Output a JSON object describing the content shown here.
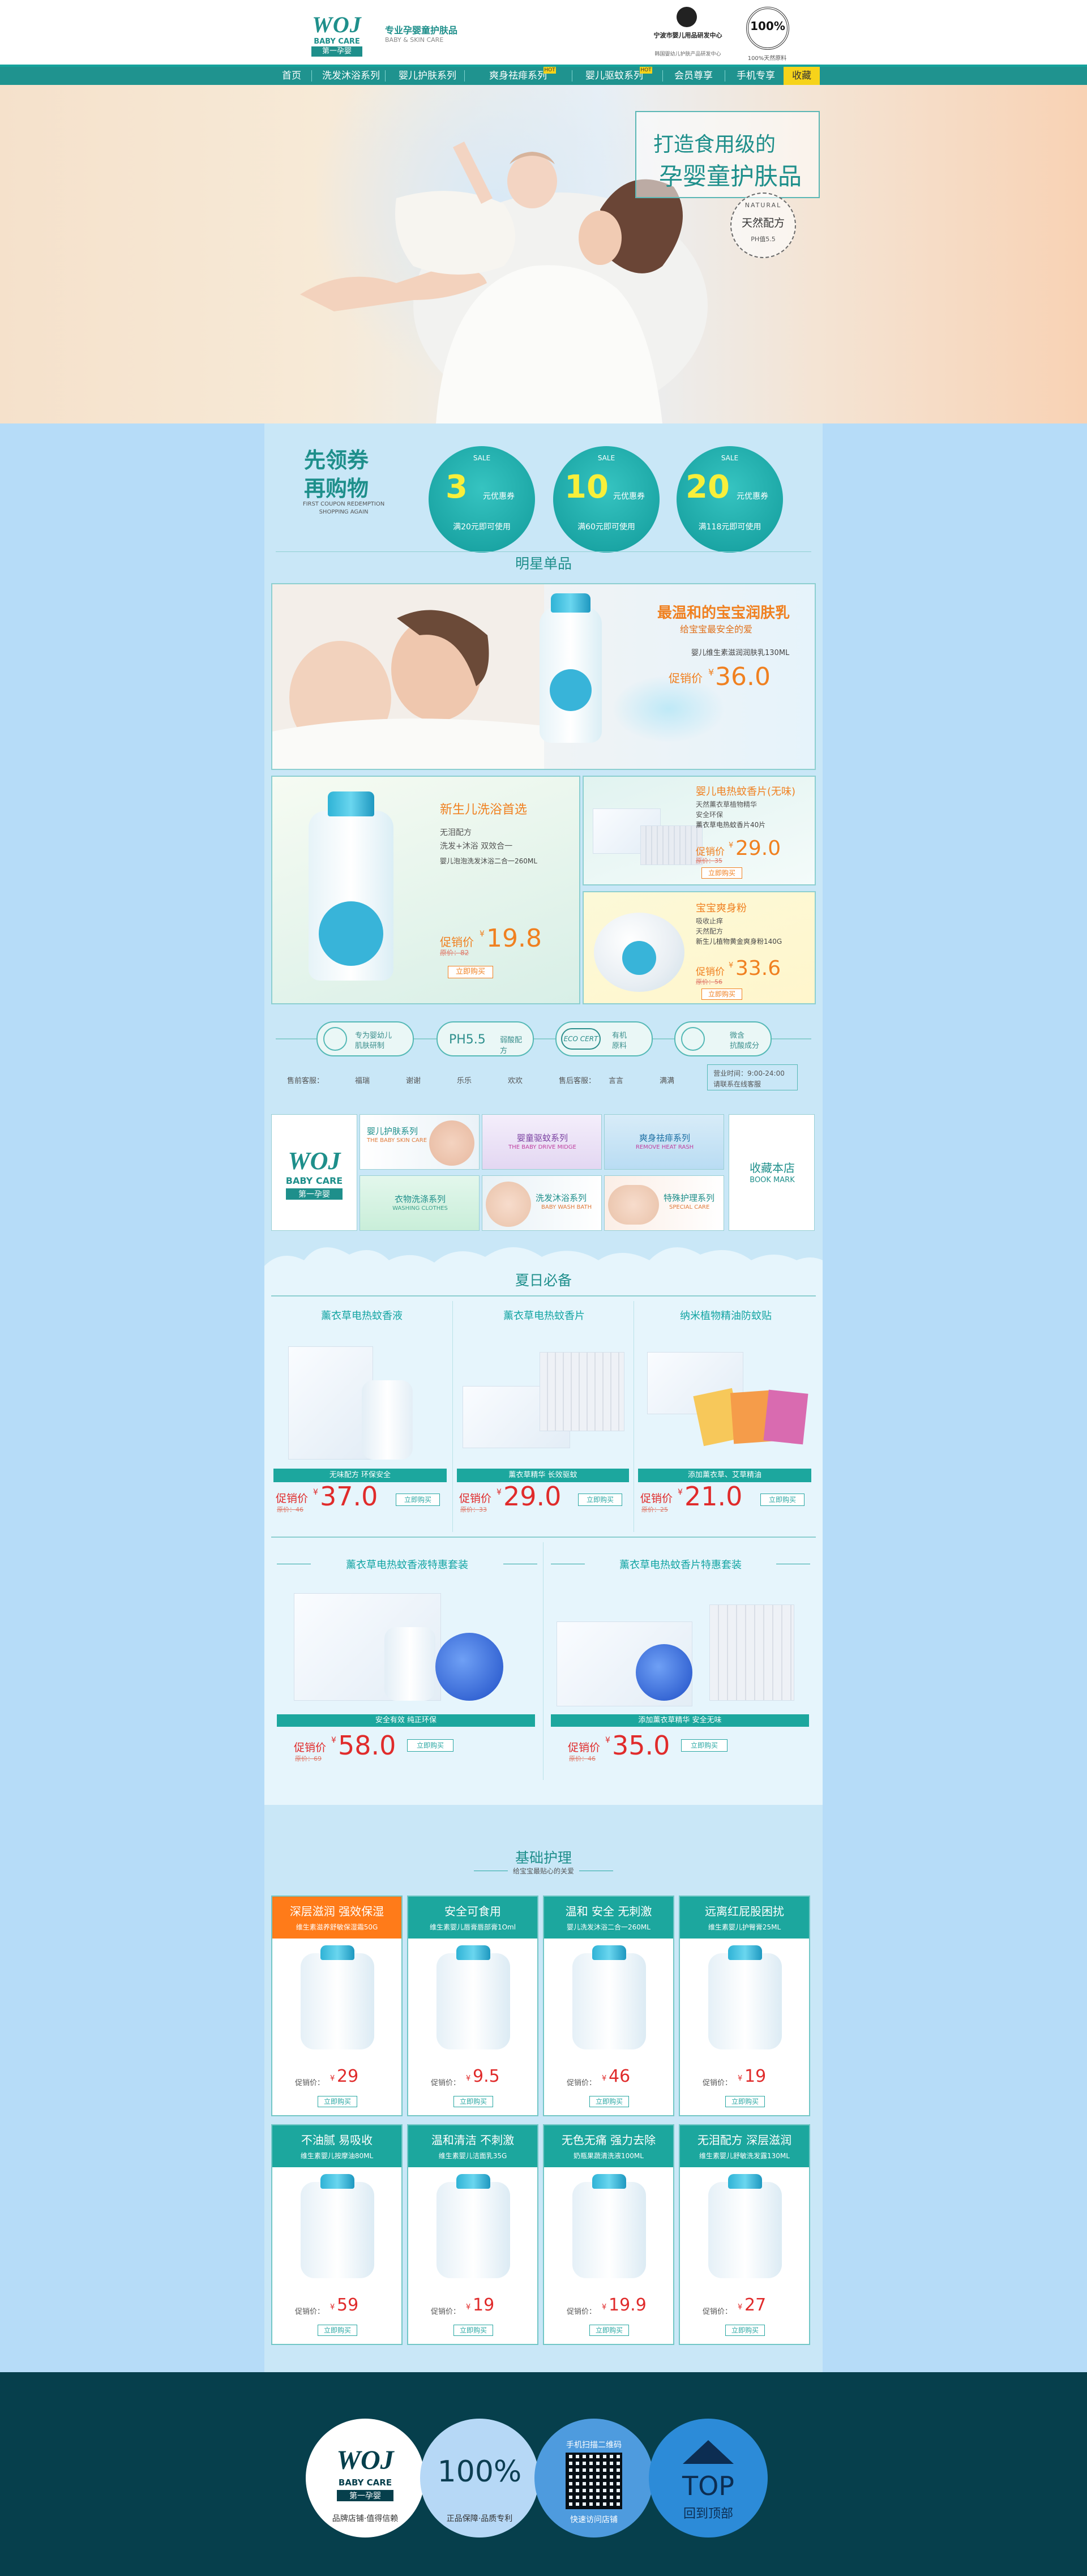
{
  "header": {
    "brand_en": "BABY CARE",
    "brand_cn": "第一孕婴",
    "brand_logo": "WOJ",
    "tagline": "专业孕婴童护肤品",
    "tagline_en": "BABY & SKIN CARE",
    "cert_text_1": "宁波市婴儿用品研发中心",
    "cert_text_2": "韩国婴幼儿护肤产品研发中心",
    "badge_100": "100%",
    "badge_sub": "100%天然原料"
  },
  "nav": {
    "items": [
      "首页",
      "洗发沐浴系列",
      "婴儿护肤系列",
      "爽身祛痱系列",
      "婴儿驱蚊系列",
      "会员尊享",
      "手机专享",
      "收藏"
    ],
    "hot_badge": "HOT"
  },
  "hero": {
    "slogan_1": "打造食用级的",
    "slogan_2": "孕婴童护肤品",
    "seal_top": "NATURAL",
    "seal_cn": "天然配方",
    "seal_bottom": "PH值5.5"
  },
  "coupons": {
    "title_1": "先领券",
    "title_2": "再购物",
    "subtitle": "FIRST COUPON REDEMPTION SHOPPING AGAIN",
    "items": [
      {
        "value": "3",
        "unit": "元优惠券",
        "cond": "满20元即可使用",
        "tag": "SALE"
      },
      {
        "value": "10",
        "unit": "元优惠券",
        "cond": "满60元即可使用",
        "tag": "SALE"
      },
      {
        "value": "20",
        "unit": "元优惠券",
        "cond": "满118元即可使用",
        "tag": "SALE"
      }
    ]
  },
  "star": {
    "title": "明星单品",
    "main": {
      "headline": "最温和的宝宝润肤乳",
      "sub": "给宝宝最安全的爱",
      "name": "婴儿维生素滋润润肤乳130ML",
      "label": "促销价",
      "price": "36.0",
      "currency": "¥"
    },
    "left": {
      "headline": "新生儿洗浴首选",
      "f1": "无泪配方",
      "f2": "洗发+沐浴 双效合一",
      "name": "婴儿泡泡洗发沐浴二合一260ML",
      "label": "促销价",
      "price": "19.8",
      "old": "原价：82",
      "currency": "¥",
      "btn": "立即购买"
    },
    "right1": {
      "headline": "婴儿电热蚊香片(无味)",
      "f1": "天然薰衣草植物精华",
      "f2": "安全环保",
      "name": "薰衣草电热蚊香片40片",
      "label": "促销价",
      "price": "29.0",
      "old": "原价：35",
      "currency": "¥",
      "btn": "立即购买"
    },
    "right2": {
      "headline": "宝宝爽身粉",
      "f1": "吸收止痒",
      "f2": "天然配方",
      "name": "新生儿植物黄金爽身粉140G",
      "label": "促销价",
      "price": "33.6",
      "old": "原价：56",
      "currency": "¥",
      "btn": "立即购买"
    }
  },
  "features": [
    {
      "title": "专为婴幼儿",
      "sub": "肌肤研制"
    },
    {
      "title": "PH5.5",
      "sub": "弱酸配方"
    },
    {
      "title": "有机",
      "sub": "原料",
      "logo": "ECO CERT"
    },
    {
      "title": "微含",
      "sub": "抗酸成分"
    }
  ],
  "service": {
    "presale": "售前客服：",
    "names_pre": [
      "福瑞",
      "谢谢",
      "乐乐",
      "欢欢"
    ],
    "aftersale": "售后客服：",
    "names_after": [
      "言言",
      "满满"
    ],
    "hours": "营业时间：9:00-24:00",
    "hours_sub": "请联系在线客服"
  },
  "categories": {
    "logo_en": "BABY CARE",
    "logo_cn": "第一孕婴",
    "items": [
      {
        "cn": "婴儿护肤系列",
        "en": "THE BABY SKIN CARE"
      },
      {
        "cn": "婴童驱蚊系列",
        "en": "THE BABY DRIVE MIDGE"
      },
      {
        "cn": "爽身祛痱系列",
        "en": "REMOVE HEAT RASH"
      },
      {
        "cn": "衣物洗涤系列",
        "en": "WASHING CLOTHES"
      },
      {
        "cn": "洗发沐浴系列",
        "en": "BABY WASH BATH"
      },
      {
        "cn": "特殊护理系列",
        "en": "SPECIAL CARE"
      }
    ],
    "bookmark_cn": "收藏本店",
    "bookmark_en": "BOOK MARK"
  },
  "summer": {
    "title": "夏日必备",
    "row1": [
      {
        "name": "薰衣草电热蚊香液",
        "strip": "无味配方 环保安全",
        "label": "促销价",
        "price": "37.0",
        "old": "原价：46",
        "btn": "立即购买"
      },
      {
        "name": "薰衣草电热蚊香片",
        "strip": "薰衣草精华 长效驱蚊",
        "label": "促销价",
        "price": "29.0",
        "old": "原价：33",
        "btn": "立即购买"
      },
      {
        "name": "纳米植物精油防蚊贴",
        "strip": "添加薰衣草、艾草精油",
        "label": "促销价",
        "price": "21.0",
        "old": "原价：25",
        "btn": "立即购买"
      }
    ],
    "row2": [
      {
        "name": "薰衣草电热蚊香液特惠套装",
        "strip": "安全有效 纯正环保",
        "label": "促销价",
        "price": "58.0",
        "old": "原价：69",
        "btn": "立即购买"
      },
      {
        "name": "薰衣草电热蚊香片特惠套装",
        "strip": "添加薰衣草精华 安全无味",
        "label": "促销价",
        "price": "35.0",
        "old": "原价：46",
        "btn": "立即购买"
      }
    ]
  },
  "basic": {
    "title": "基础护理",
    "subtitle": "给宝宝最贴心的关爱",
    "items": [
      {
        "h1": "深层滋润 强效保湿",
        "h2": "维生素滋养舒敏保湿霜50G",
        "price": "29",
        "label": "促销价：",
        "btn": "立即购买"
      },
      {
        "h1": "安全可食用",
        "h2": "维生素婴儿唇膏唇部膏1Oml",
        "price": "9.5",
        "label": "促销价：",
        "btn": "立即购买"
      },
      {
        "h1": "温和 安全 无刺激",
        "h2": "婴儿洗发沐浴二合一260ML",
        "price": "46",
        "label": "促销价：",
        "btn": "立即购买"
      },
      {
        "h1": "远离红屁股困扰",
        "h2": "维生素婴儿护臀膏25ML",
        "price": "19",
        "label": "促销价：",
        "btn": "立即购买"
      },
      {
        "h1": "不油腻 易吸收",
        "h2": "维生素婴儿按摩油80ML",
        "price": "59",
        "label": "促销价：",
        "btn": "立即购买"
      },
      {
        "h1": "温和清洁 不刺激",
        "h2": "维生素婴儿洁面乳35G",
        "price": "19",
        "label": "促销价：",
        "btn": "立即购买"
      },
      {
        "h1": "无色无痛 强力去除",
        "h2": "奶瓶果蔬清洗液100ML",
        "price": "19.9",
        "label": "促销价：",
        "btn": "立即购买"
      },
      {
        "h1": "无泪配方 深层滋润",
        "h2": "维生素婴儿舒敏洗发露130ML",
        "price": "27",
        "label": "促销价：",
        "btn": "立即购买"
      }
    ],
    "currency": "¥"
  },
  "footer": {
    "logo_cn": "第一孕婴",
    "logo_en": "BABY CARE",
    "c1_text": "品牌店铺·值得信赖",
    "c2_big": "100%",
    "c2_text": "正品保障·品质专利",
    "c3_top": "手机扫描二维码",
    "c3_text": "快速访问店铺",
    "c4_big": "TOP",
    "c4_text": "回到顶部"
  },
  "colors": {
    "teal": "#1ca79e",
    "teal_dark": "#063f4c",
    "orange": "#f08020",
    "red": "#e02b2b",
    "sky": "#b6dcf8"
  }
}
